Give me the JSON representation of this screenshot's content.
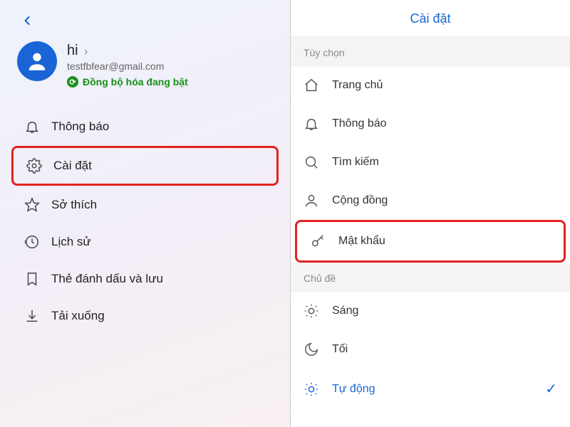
{
  "left": {
    "profile": {
      "name": "hi",
      "email": "testfbfear@gmail.com",
      "sync_label": "Đồng bộ hóa đang bật"
    },
    "menu": [
      {
        "label": "Thông báo"
      },
      {
        "label": "Cài đặt"
      },
      {
        "label": "Sở thích"
      },
      {
        "label": "Lịch sử"
      },
      {
        "label": "Thẻ đánh dấu và lưu"
      },
      {
        "label": "Tải xuống"
      }
    ]
  },
  "right": {
    "title": "Cài đặt",
    "section_options": "Tùy chọn",
    "options": [
      {
        "label": "Trang chủ"
      },
      {
        "label": "Thông báo"
      },
      {
        "label": "Tìm kiếm"
      },
      {
        "label": "Cộng đồng"
      },
      {
        "label": "Mật khẩu"
      }
    ],
    "section_theme": "Chủ đề",
    "themes": [
      {
        "label": "Sáng"
      },
      {
        "label": "Tối"
      },
      {
        "label": "Tự động",
        "selected": true
      }
    ]
  }
}
